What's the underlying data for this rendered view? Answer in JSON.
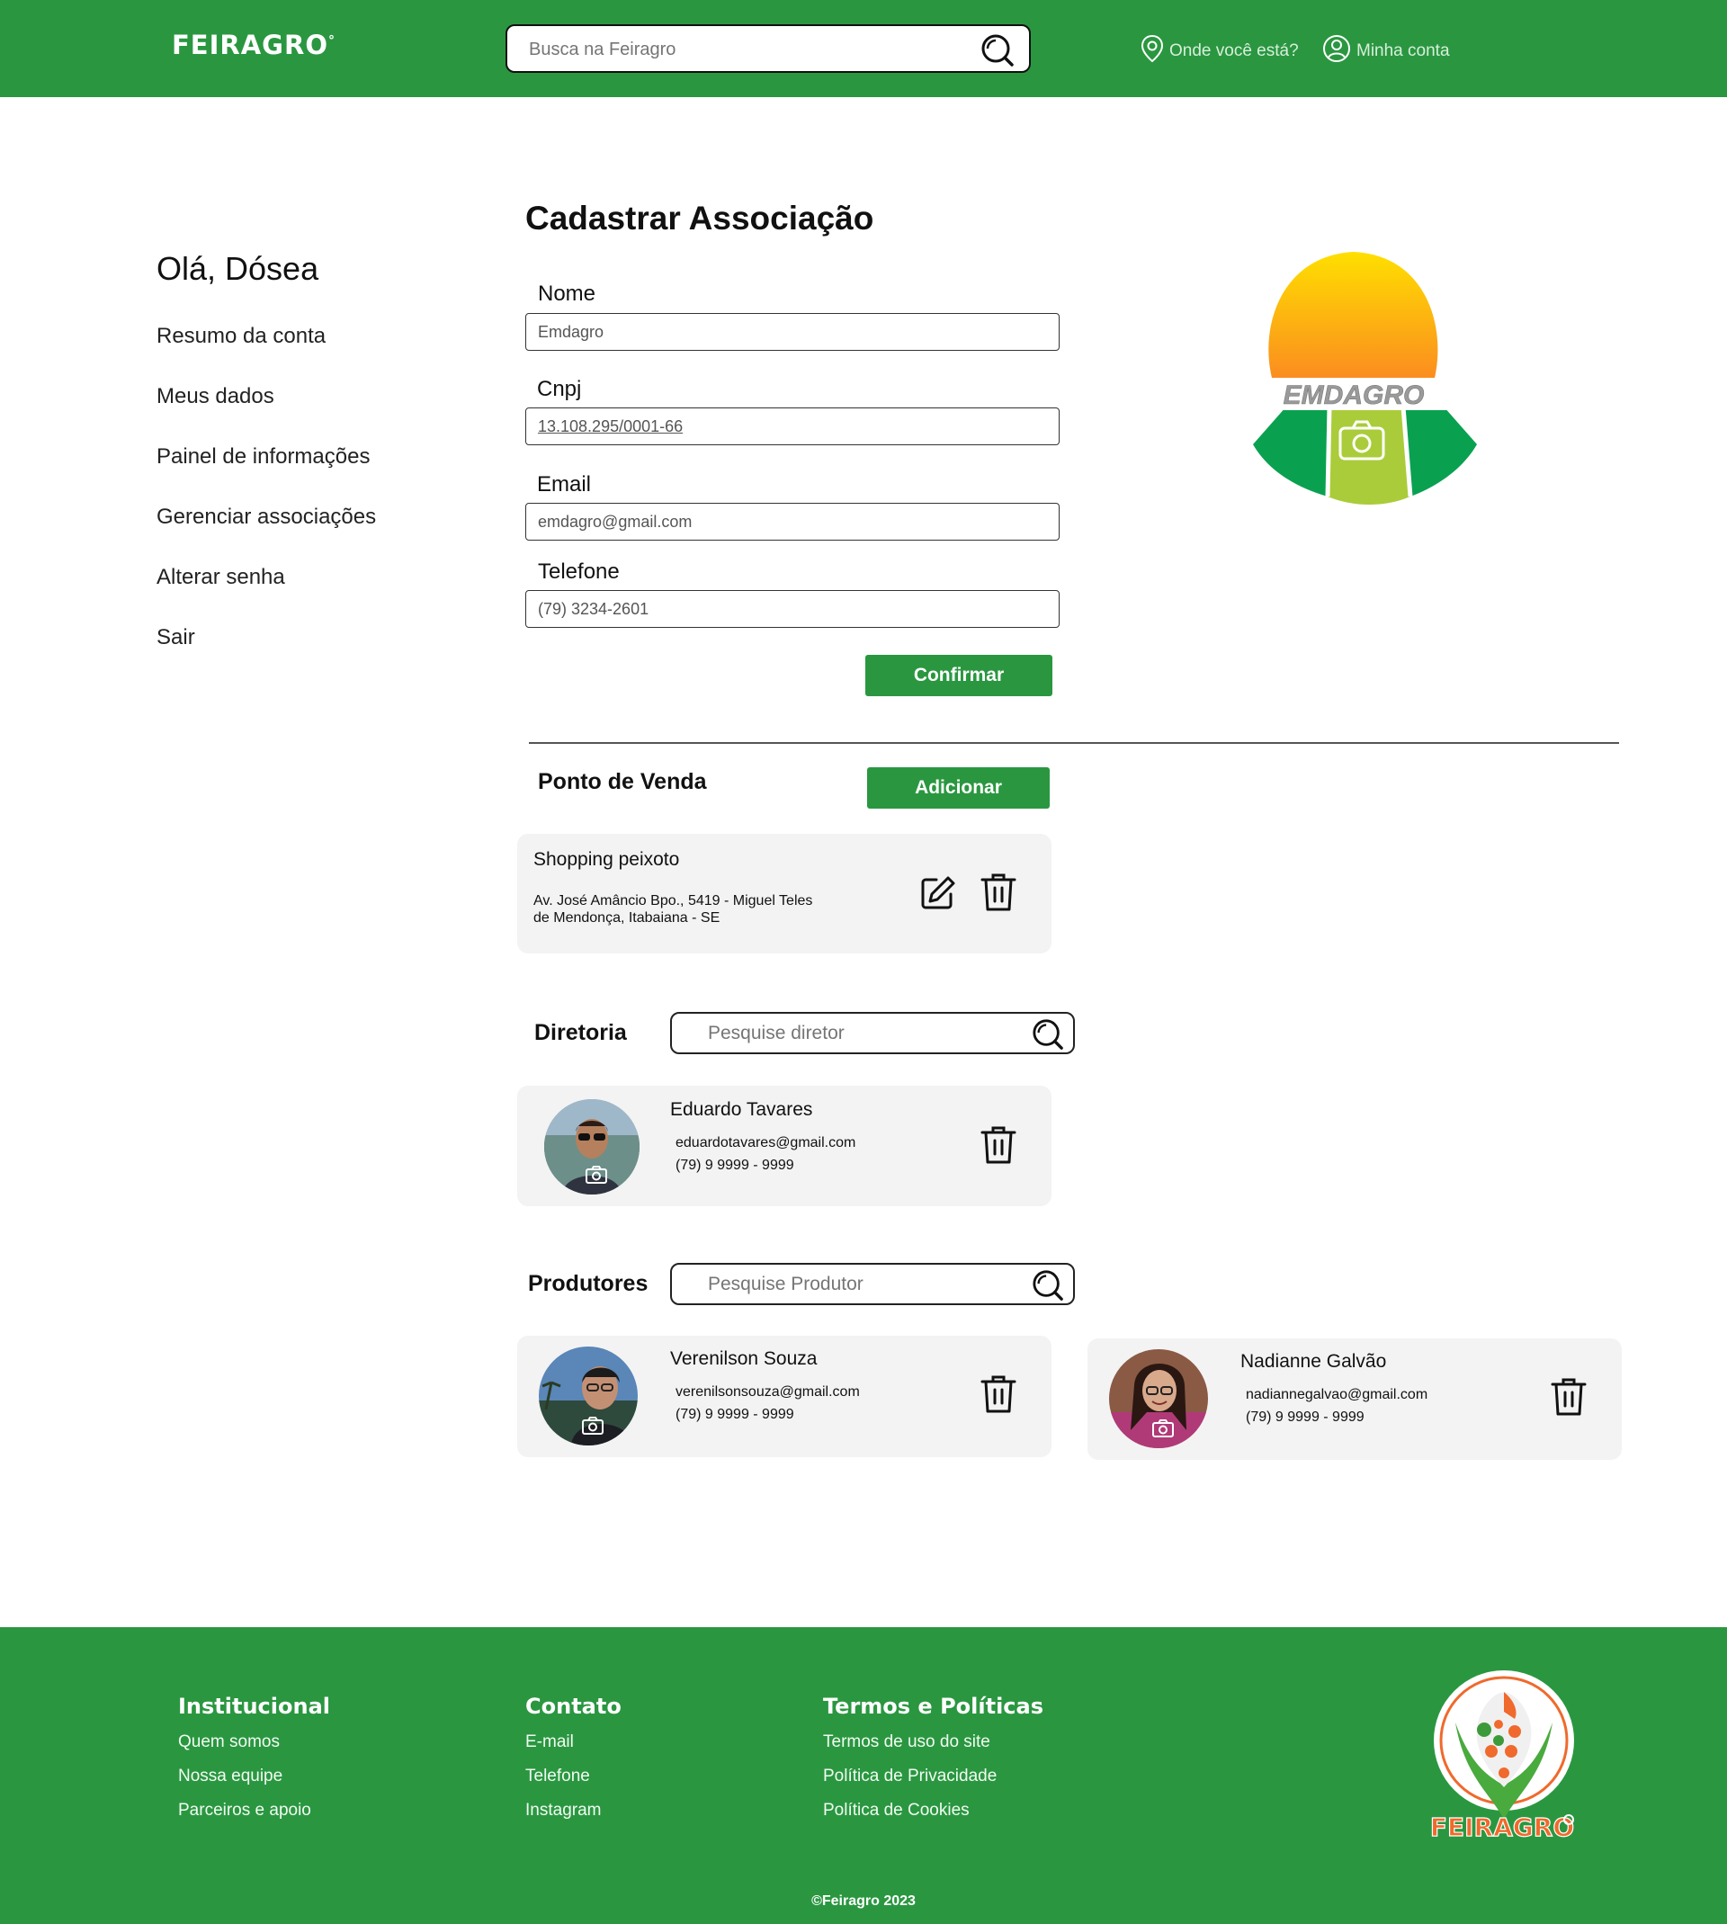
{
  "colors": {
    "brand_green": "#2a9740",
    "card_bg": "#f3f3f3",
    "sun_yellow": "#ffd900",
    "leaf_green": "#aacc3a",
    "dark_leaf": "#09a150"
  },
  "header": {
    "logo": "FEIRAGRO",
    "search_placeholder": "Busca na Feiragro",
    "where_label": "Onde você está?",
    "account_label": "Minha conta"
  },
  "sidebar": {
    "greeting": "Olá, Dósea",
    "items": [
      {
        "label": "Resumo da conta"
      },
      {
        "label": "Meus dados"
      },
      {
        "label": "Painel de informações"
      },
      {
        "label": "Gerenciar associações"
      },
      {
        "label": "Alterar senha"
      },
      {
        "label": "Sair"
      }
    ]
  },
  "form": {
    "title": "Cadastrar Associação",
    "fields": [
      {
        "label": "Nome",
        "value": "Emdagro"
      },
      {
        "label": "Cnpj",
        "value": "13.108.295/0001-66"
      },
      {
        "label": "Email",
        "value": "emdagro@gmail.com"
      },
      {
        "label": "Telefone",
        "value": "(79) 3234-2601"
      }
    ],
    "confirm_label": "Confirmar",
    "logo_text": "EMDAGRO"
  },
  "ponto_venda": {
    "title": "Ponto de Venda",
    "add_label": "Adicionar",
    "items": [
      {
        "name": "Shopping peixoto",
        "address_line1": "Av. José Amâncio Bpo., 5419 - Miguel Teles",
        "address_line2": "de Mendonça, Itabaiana - SE"
      }
    ]
  },
  "diretoria": {
    "title": "Diretoria",
    "search_placeholder": "Pesquise diretor",
    "members": [
      {
        "name": "Eduardo Tavares",
        "email": "eduardotavares@gmail.com",
        "phone": "(79) 9 9999 - 9999"
      }
    ]
  },
  "produtores": {
    "title": "Produtores",
    "search_placeholder": "Pesquise Produtor",
    "members": [
      {
        "name": "Verenilson Souza",
        "email": "verenilsonsouza@gmail.com",
        "phone": "(79) 9 9999 - 9999"
      },
      {
        "name": "Nadianne Galvão",
        "email": "nadiannegalvao@gmail.com",
        "phone": "(79) 9 9999 - 9999"
      }
    ]
  },
  "footer": {
    "institucional": {
      "title": "Institucional",
      "links": [
        "Quem somos",
        "Nossa equipe",
        "Parceiros e apoio"
      ]
    },
    "contato": {
      "title": "Contato",
      "links": [
        "E-mail",
        "Telefone",
        "Instagram"
      ]
    },
    "termos": {
      "title": "Termos e Políticas",
      "links": [
        "Termos de uso do site",
        "Política de Privacidade",
        "Política de Cookies"
      ]
    },
    "logo_text": "FEIRAGRO",
    "copyright": "©Feiragro 2023"
  }
}
